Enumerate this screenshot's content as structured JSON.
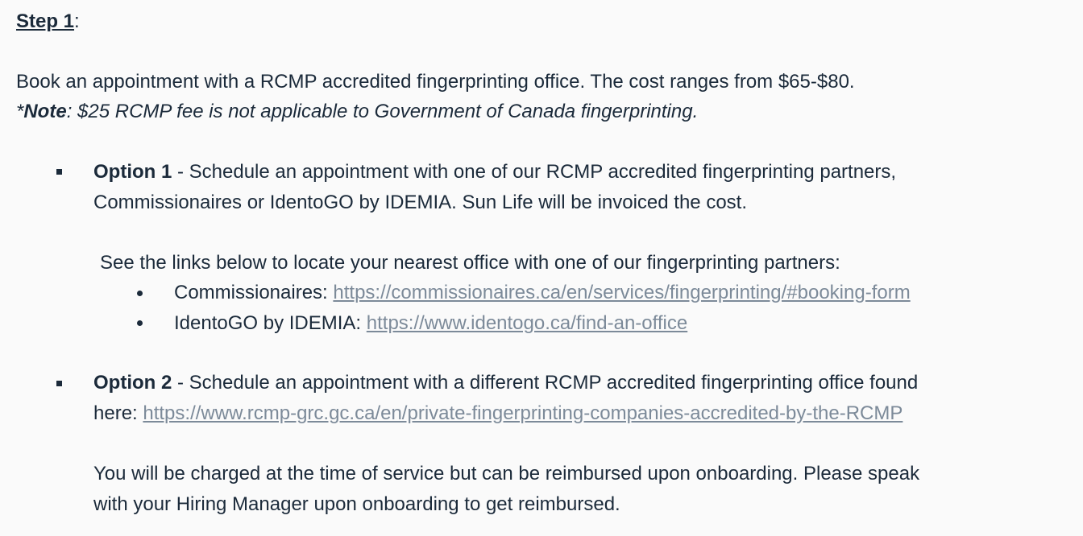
{
  "step": {
    "title": "Step 1",
    "colon": ":"
  },
  "intro": {
    "text": "Book an appointment with a RCMP accredited fingerprinting office. The cost ranges from $65-$80.",
    "note_prefix": "*",
    "note_label": "Note",
    "note_text": ":  $25 RCMP fee is not applicable to Government of Canada fingerprinting."
  },
  "option1": {
    "label": "Option 1",
    "text_line1": " - Schedule an appointment with one of our RCMP accredited fingerprinting partners,",
    "text_line2": "Commissionaires or IdentoGO by IDEMIA. Sun Life will be invoiced the cost.",
    "links_intro": "See the links below to locate your nearest office with one of our fingerprinting partners:",
    "partners": [
      {
        "name": "Commissionaires: ",
        "url": "https://commissionaires.ca/en/services/fingerprinting/#booking-form"
      },
      {
        "name": "IdentoGO by IDEMIA: ",
        "url": "https://www.identogo.ca/find-an-office"
      }
    ]
  },
  "option2": {
    "label": "Option 2",
    "text_line1": " - Schedule an appointment with a different RCMP accredited fingerprinting office found",
    "here": "here: ",
    "url": "https://www.rcmp-grc.gc.ca/en/private-fingerprinting-companies-accredited-by-the-RCMP",
    "reimburse_line1": "You will be charged at the time of service but can be reimbursed upon onboarding. Please speak",
    "reimburse_line2": "with your Hiring Manager upon onboarding to get reimbursed."
  }
}
